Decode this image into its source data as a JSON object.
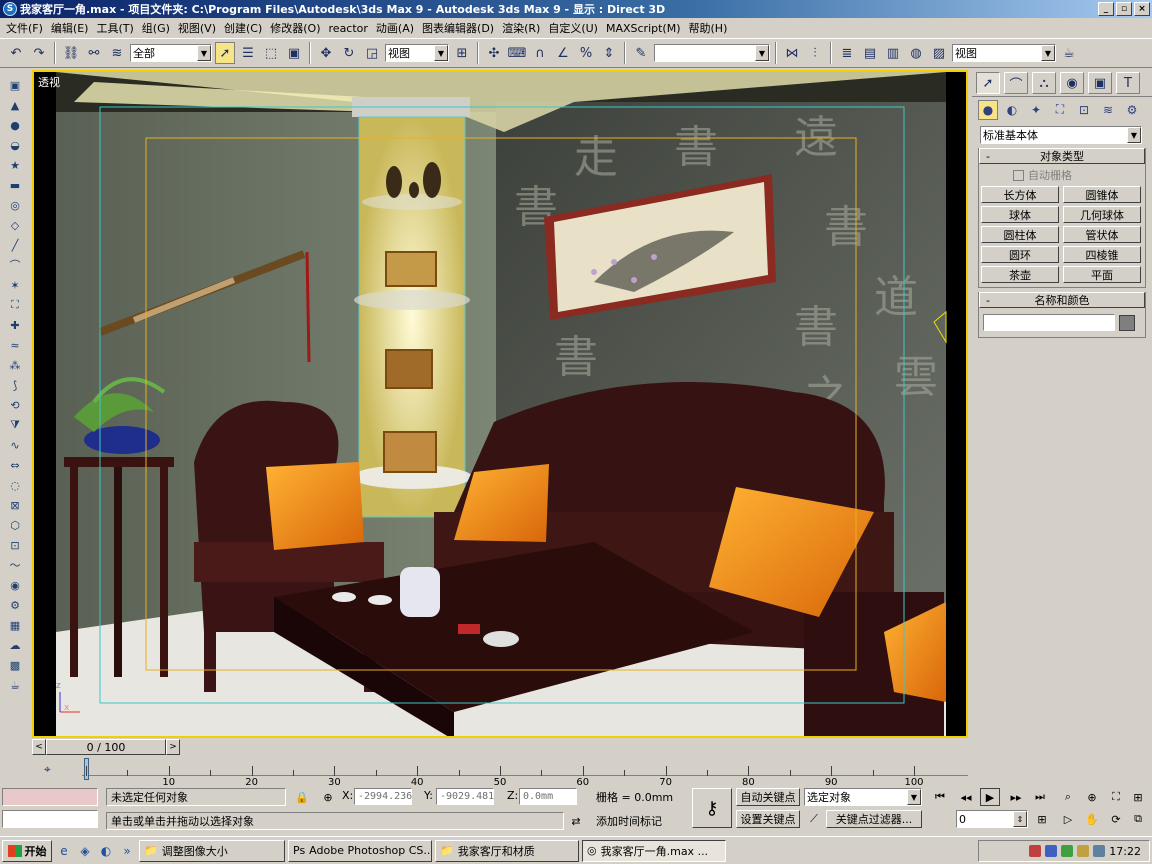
{
  "window": {
    "title": "我家客厅一角.max   - 项目文件夹: C:\\Program Files\\Autodesk\\3ds Max 9   - Autodesk 3ds Max 9   - 显示 : Direct 3D",
    "controls": [
      "_",
      "▫",
      "×"
    ]
  },
  "menu": [
    "文件(F)",
    "编辑(E)",
    "工具(T)",
    "组(G)",
    "视图(V)",
    "创建(C)",
    "修改器(O)",
    "reactor",
    "动画(A)",
    "图表编辑器(D)",
    "渲染(R)",
    "自定义(U)",
    "MAXScript(M)",
    "帮助(H)"
  ],
  "toolbar": {
    "selection_filter": "全部",
    "reference_coord": "视图",
    "named_selection": "",
    "render_view": "视图"
  },
  "viewport": {
    "label": "透视"
  },
  "command_panel": {
    "category": "标准基本体",
    "object_type_title": "对象类型",
    "autogrid_label": "自动栅格",
    "buttons": [
      "长方体",
      "圆锥体",
      "球体",
      "几何球体",
      "圆柱体",
      "管状体",
      "圆环",
      "四棱锥",
      "茶壶",
      "平面"
    ],
    "name_color_title": "名称和颜色",
    "rollout_toggle": "-"
  },
  "timeline": {
    "frame_display": "0 / 100",
    "ticks": [
      "10",
      "20",
      "30",
      "40",
      "50",
      "60",
      "70",
      "80",
      "90",
      "100"
    ]
  },
  "status": {
    "selection_info": "未选定任何对象",
    "prompt": "单击或单击并拖动以选择对象",
    "x_label": "X:",
    "y_label": "Y:",
    "z_label": "Z:",
    "x_value": "-2994.236",
    "y_value": "-9029.481",
    "z_value": "0.0mm",
    "grid": "栅格 = 0.0mm",
    "add_time_tag": "添加时间标记",
    "auto_key": "自动关键点",
    "set_key": "设置关键点",
    "selected_object": "选定对象",
    "key_filters": "关键点过滤器...",
    "current_frame": "0"
  },
  "taskbar": {
    "start": "开始",
    "tasks": [
      "调整图像大小",
      "Adobe Photoshop CS...",
      "我家客厅和材质",
      "我家客厅一角.max ..."
    ],
    "clock": "17:22"
  },
  "colors": {
    "title_start": "#0a246a",
    "viewport_border": "#f0d000",
    "active_tool": "#f6e486",
    "object_color": "#7f7f7f"
  }
}
